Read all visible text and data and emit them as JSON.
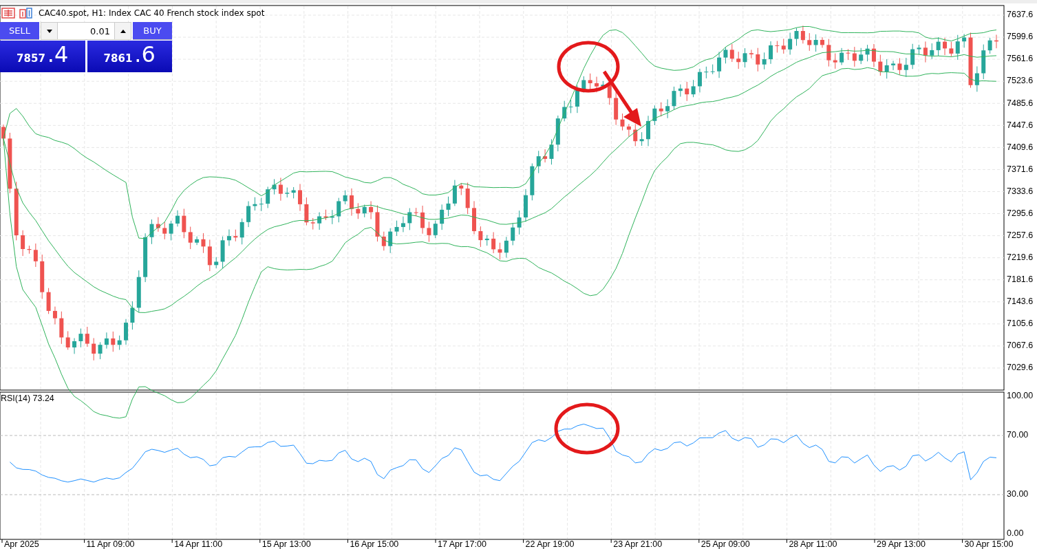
{
  "header": {
    "title": "CAC40.spot, H1:  Index CAC 40 French stock index spot"
  },
  "trade_panel": {
    "sell_label": "SELL",
    "buy_label": "BUY",
    "volume": "0.01",
    "sell_price": {
      "whole": "7857",
      "fraction": ".4"
    },
    "buy_price": {
      "whole": "7861",
      "fraction": ".6"
    }
  },
  "price_axis": {
    "labels": [
      "7637.6",
      "7599.6",
      "7561.6",
      "7523.6",
      "7485.6",
      "7447.6",
      "7409.6",
      "7371.6",
      "7333.6",
      "7295.6",
      "7257.6",
      "7219.6",
      "7181.6",
      "7143.6",
      "7105.6",
      "7067.6",
      "7029.6"
    ]
  },
  "rsi": {
    "label": "RSI(14) 73.24",
    "axis_labels": [
      "100.00",
      "70.00",
      "30.00",
      "0.00"
    ]
  },
  "time_axis": {
    "labels": [
      "Apr 2025",
      "11 Apr 09:00",
      "14 Apr 11:00",
      "15 Apr 13:00",
      "16 Apr 15:00",
      "17 Apr 17:00",
      "22 Apr 19:00",
      "23 Apr 21:00",
      "25 Apr 09:00",
      "28 Apr 11:00",
      "29 Apr 13:00",
      "30 Apr 15:00"
    ]
  }
}
